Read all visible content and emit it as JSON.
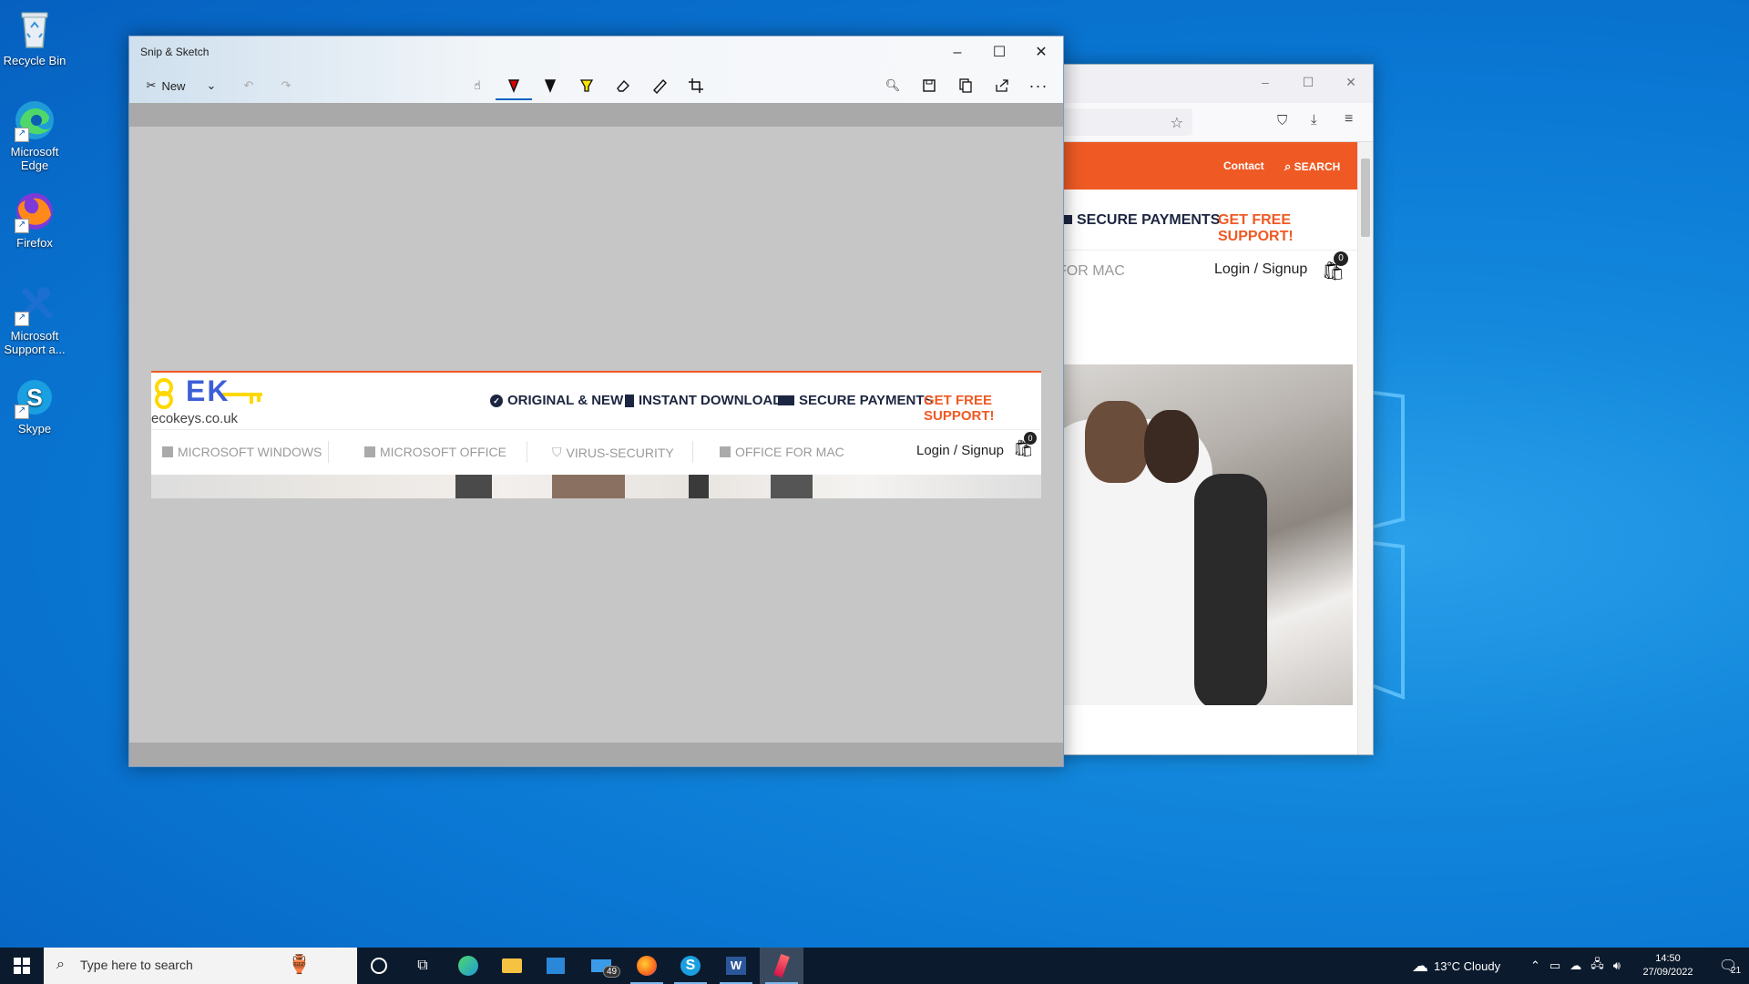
{
  "desktop": {
    "icons": [
      {
        "label": "Recycle Bin"
      },
      {
        "label": "Microsoft Edge"
      },
      {
        "label": "Firefox"
      },
      {
        "label": "Microsoft Support a..."
      },
      {
        "label": "Skype"
      }
    ]
  },
  "snip": {
    "title": "Snip & Sketch",
    "new_label": "New",
    "tools": [
      "touch-writing-icon",
      "ballpoint-pen-icon",
      "pencil-icon",
      "highlighter-icon",
      "eraser-icon",
      "ruler-icon",
      "crop-icon"
    ],
    "actions": [
      "zoom-icon",
      "save-icon",
      "copy-icon",
      "share-icon",
      "more-icon"
    ]
  },
  "captured_page": {
    "logo_text": "ecokeys.co.uk",
    "logo_letters": "EK",
    "features": [
      "ORIGINAL & NEW",
      "INSTANT DOWNLOAD",
      "SECURE PAYMENTS",
      "GET FREE SUPPORT!"
    ],
    "menu": [
      "MICROSOFT WINDOWS",
      "MICROSOFT OFFICE",
      "VIRUS-SECURITY",
      "OFFICE FOR MAC"
    ],
    "login": "Login / Signup",
    "cart_count": "0"
  },
  "firefox": {
    "contact": "Contact",
    "search": "SEARCH",
    "secure": "SECURE PAYMENTS",
    "support": "GET FREE SUPPORT!",
    "menu_partial": "FOR MAC",
    "login": "Login / Signup",
    "cart_count": "0"
  },
  "taskbar": {
    "search_placeholder": "Type here to search",
    "mail_badge": "49",
    "weather": "13°C  Cloudy",
    "time": "14:50",
    "date": "27/09/2022",
    "notifications": "21"
  },
  "colors": {
    "accent_orange": "#ef5a24",
    "navy": "#1d2640",
    "taskbar": "#0c1a2d"
  }
}
